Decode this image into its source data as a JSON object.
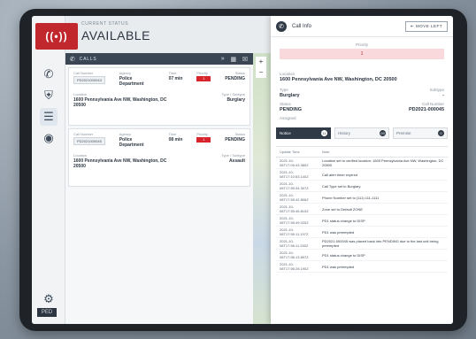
{
  "app": {
    "status_label": "CURRENT STATUS",
    "status_value": "AVAILABLE",
    "logo_glyph": "((•))",
    "bottom_badge": "PED"
  },
  "calls_panel": {
    "title": "CALLS",
    "calls": [
      {
        "id_label": "Call Number",
        "id_value": "PD2021000043",
        "agency_label": "Agency",
        "agency_value": "Police Department",
        "time_label": "Time",
        "time_value": "07 min",
        "priority_label": "Priority",
        "priority_value": "1",
        "status_label": "Status",
        "status_value": "PENDING",
        "location_label": "Location",
        "location_value": "1600 Pennsylvania Ave NW, Washington, DC 20500",
        "type_label": "Type / Subtype",
        "type_value": "Burglary"
      },
      {
        "id_label": "Call Number",
        "id_value": "PD2021000045",
        "agency_label": "Agency",
        "agency_value": "Police Department",
        "time_label": "Time",
        "time_value": "08 min",
        "priority_label": "Priority",
        "priority_value": "1",
        "status_label": "Status",
        "status_value": "PENDING",
        "location_label": "Location",
        "location_value": "1600 Pennsylvania Ave NW, Washington, DC 20500",
        "type_label": "Type / Subtype",
        "type_value": "Assault"
      }
    ]
  },
  "drawer": {
    "title": "Call Info",
    "move_button": "MOVE LEFT",
    "priority_label": "Priority",
    "priority_value": "1",
    "location_label": "Location",
    "location_value": "1600 Pennsylvania Ave NW, Washington, DC 20500",
    "type_label": "Type",
    "type_value": "Burglary",
    "subtype_label": "Subtype",
    "subtype_value": "-",
    "status_label": "Status",
    "status_value": "PENDING",
    "callnum_label": "Call Number",
    "callnum_value": "PD2021-000045",
    "assigned_label": "Assigned",
    "tabs": [
      {
        "label": "Notice",
        "count": "11"
      },
      {
        "label": "History",
        "count": "09"
      },
      {
        "label": "Premise",
        "count": "0"
      }
    ],
    "table_head": {
      "time": "Update Time",
      "note": "Note"
    },
    "rows": [
      {
        "time": "2021-10-08T17:09:43.380Z",
        "note": "Location set to verified location: 1600 Pennsylvania Ave NW, Washington, DC 20500"
      },
      {
        "time": "2021-10-08T17:10:53.140Z",
        "note": "Call alert timer expired"
      },
      {
        "time": "2021-10-08T17:55:34.307Z",
        "note": "Call Type set to Burglary"
      },
      {
        "time": "2021-10-08T17:55:42.806Z",
        "note": "Phone Number set to (111) 111-1111"
      },
      {
        "time": "2021-10-08T17:55:45.810Z",
        "note": "Zone set to Default ZONE"
      },
      {
        "time": "2021-10-08T17:55:49.020Z",
        "note": "PD1 status change to DISP"
      },
      {
        "time": "2021-10-08T17:55:11.197Z",
        "note": "PD1 was preempted"
      },
      {
        "time": "2021-10-08T17:56:11.250Z",
        "note": "PD2021-000045 was placed back into PENDING due to the last unit being preempted"
      },
      {
        "time": "2021-10-08T17:56:13.897Z",
        "note": "PD1 status change to DISP"
      },
      {
        "time": "2021-10-08T17:56:28.190Z",
        "note": "PD1 was preempted"
      }
    ]
  }
}
